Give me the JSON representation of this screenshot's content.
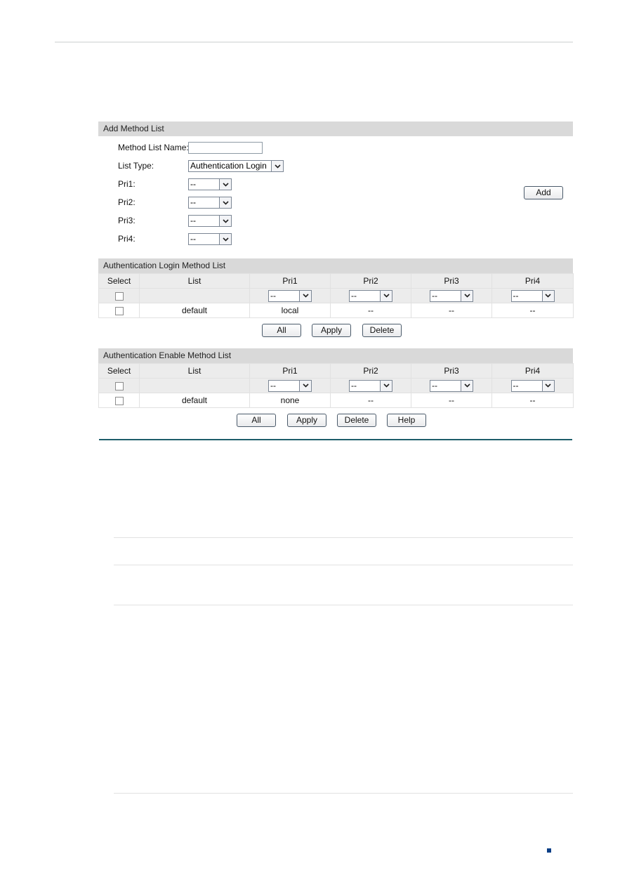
{
  "add_panel": {
    "title": "Add Method List",
    "method_list_name_label": "Method List Name:",
    "method_list_name_value": "",
    "list_type_label": "List Type:",
    "list_type_value": "Authentication Login",
    "pri_fields": [
      {
        "label": "Pri1:",
        "value": "--"
      },
      {
        "label": "Pri2:",
        "value": "--"
      },
      {
        "label": "Pri3:",
        "value": "--"
      },
      {
        "label": "Pri4:",
        "value": "--"
      }
    ],
    "add_button": "Add"
  },
  "login_list": {
    "title": "Authentication Login Method List",
    "columns": [
      "Select",
      "List",
      "Pri1",
      "Pri2",
      "Pri3",
      "Pri4"
    ],
    "filter_row": {
      "pri1": "--",
      "pri2": "--",
      "pri3": "--",
      "pri4": "--"
    },
    "rows": [
      {
        "list": "default",
        "pri1": "local",
        "pri2": "--",
        "pri3": "--",
        "pri4": "--"
      }
    ],
    "buttons": {
      "all": "All",
      "apply": "Apply",
      "delete": "Delete"
    }
  },
  "enable_list": {
    "title": "Authentication Enable Method List",
    "columns": [
      "Select",
      "List",
      "Pri1",
      "Pri2",
      "Pri3",
      "Pri4"
    ],
    "filter_row": {
      "pri1": "--",
      "pri2": "--",
      "pri3": "--",
      "pri4": "--"
    },
    "rows": [
      {
        "list": "default",
        "pri1": "none",
        "pri2": "--",
        "pri3": "--",
        "pri4": "--"
      }
    ],
    "buttons": {
      "all": "All",
      "apply": "Apply",
      "delete": "Delete",
      "help": "Help"
    }
  },
  "colors": {
    "panel_header": "#d9d9d9",
    "table_header": "#ececec",
    "divider": "#1d5e6a",
    "page_marker": "#0b3e86"
  }
}
